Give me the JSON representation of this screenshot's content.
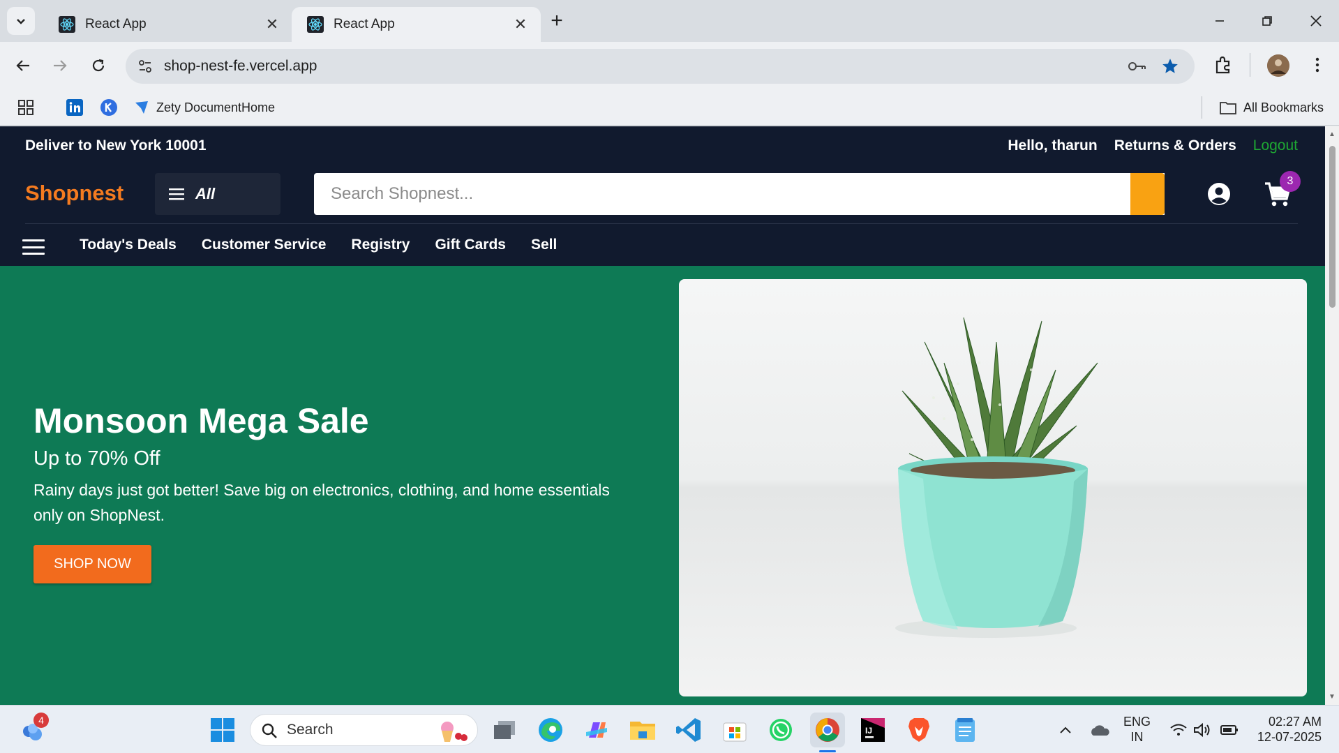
{
  "browser": {
    "tabs": [
      {
        "title": "React App"
      },
      {
        "title": "React App"
      }
    ],
    "url": "shop-nest-fe.vercel.app",
    "bookmarks": {
      "zety": "Zety DocumentHome",
      "all": "All Bookmarks"
    }
  },
  "header": {
    "deliver": "Deliver to New York 10001",
    "greeting": "Hello, tharun",
    "orders": "Returns & Orders",
    "logout": "Logout",
    "brand": "Shopnest",
    "all_label": "All",
    "search_placeholder": "Search Shopnest...",
    "cart_count": "3"
  },
  "subnav": [
    "Today's Deals",
    "Customer Service",
    "Registry",
    "Gift Cards",
    "Sell"
  ],
  "hero": {
    "title": "Monsoon Mega Sale",
    "subtitle": "Up to 70% Off",
    "description": "Rainy days just got better! Save big on electronics, clothing, and home essentials only on ShopNest.",
    "cta": "SHOP NOW"
  },
  "taskbar": {
    "widget_badge": "4",
    "search_placeholder": "Search",
    "lang_top": "ENG",
    "lang_bottom": "IN",
    "time": "02:27 AM",
    "date": "12-07-2025"
  },
  "colors": {
    "header_bg": "#111a2e",
    "brand": "#f47b20",
    "search_button": "#f9a212",
    "hero_bg": "#0e7a55",
    "cta": "#f26b1d",
    "logout": "#1ea833",
    "cart_badge": "#9c27b0"
  }
}
